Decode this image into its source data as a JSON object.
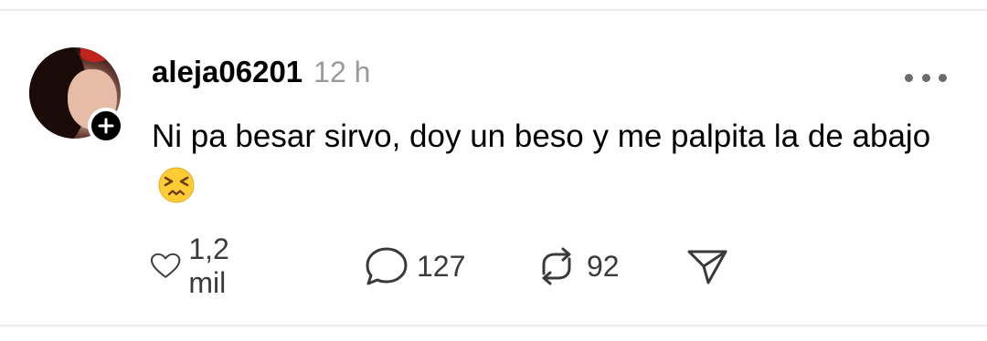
{
  "post": {
    "username": "aleja06201",
    "timestamp": "12 h",
    "text": "Ni pa besar sirvo, doy un beso y me palpita la de abajo",
    "emoji": "persevering-face",
    "avatar": "profile-photo",
    "actions": {
      "likes": "1,2 mil",
      "replies": "127",
      "reposts": "92"
    }
  },
  "icons": {
    "follow": "plus-icon",
    "more": "ellipsis-icon",
    "like": "heart-icon",
    "reply": "speech-bubble-icon",
    "repost": "repost-icon",
    "share": "send-icon"
  },
  "colors": {
    "text": "#000000",
    "muted": "#9a9a9a",
    "icon": "#3a3a3a",
    "emoji": "#ffcc33"
  }
}
